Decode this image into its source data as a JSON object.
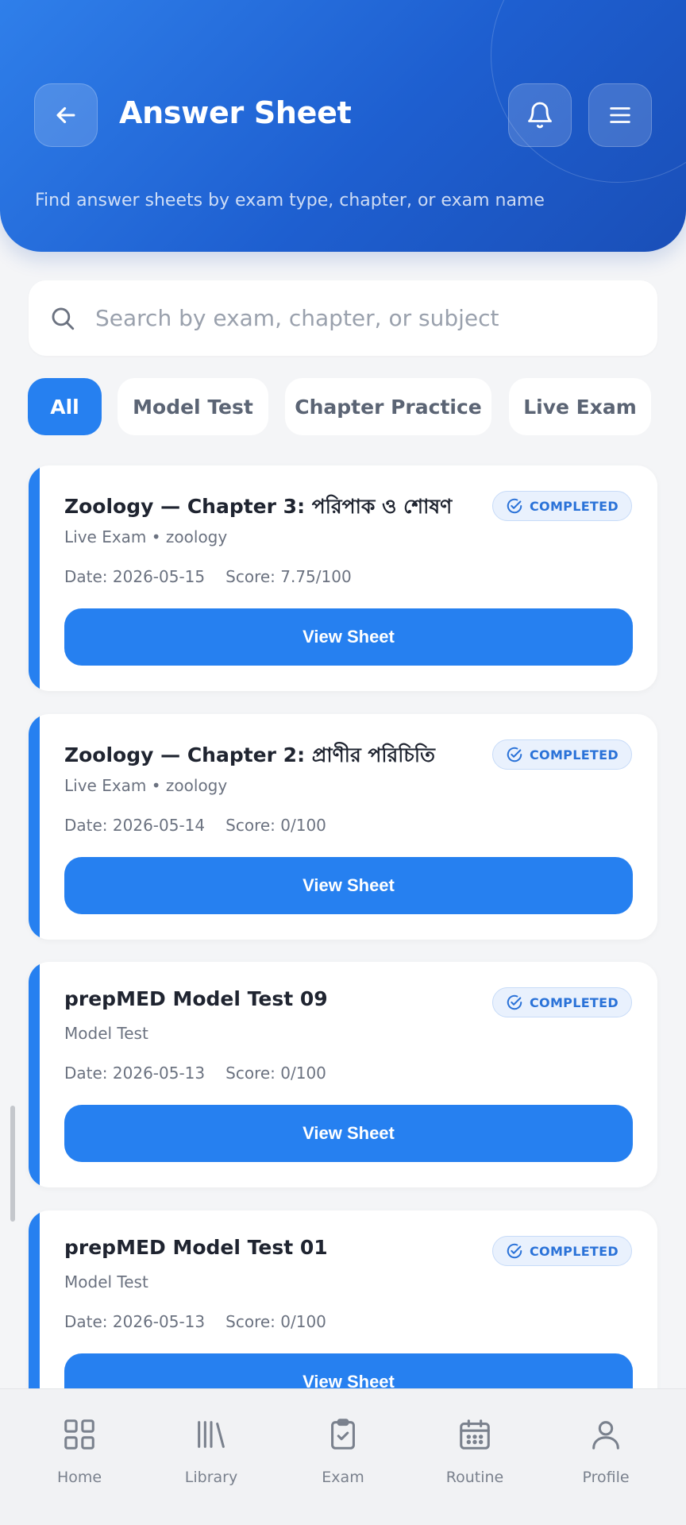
{
  "header": {
    "title": "Answer Sheet",
    "subtitle": "Find answer sheets by exam type, chapter, or exam name"
  },
  "search": {
    "placeholder": "Search by exam, chapter, or subject",
    "value": ""
  },
  "filters": [
    {
      "label": "All",
      "active": true
    },
    {
      "label": "Model Test",
      "active": false
    },
    {
      "label": "Chapter Practice",
      "active": false
    },
    {
      "label": "Live Exam",
      "active": false
    }
  ],
  "cards": [
    {
      "title": "Zoology — Chapter 3: পরিপাক ও শোষণ",
      "meta": "Live Exam • zoology",
      "date": "Date: 2026-05-15",
      "score": "Score: 7.75/100",
      "status": "COMPLETED",
      "button": "View Sheet"
    },
    {
      "title": "Zoology — Chapter 2: প্রাণীর পরিচিতি",
      "meta": "Live Exam • zoology",
      "date": "Date: 2026-05-14",
      "score": "Score: 0/100",
      "status": "COMPLETED",
      "button": "View Sheet"
    },
    {
      "title": "prepMED Model Test 09",
      "meta": "Model Test",
      "date": "Date: 2026-05-13",
      "score": "Score: 0/100",
      "status": "COMPLETED",
      "button": "View Sheet"
    },
    {
      "title": "prepMED Model Test 01",
      "meta": "Model Test",
      "date": "Date: 2026-05-13",
      "score": "Score: 0/100",
      "status": "COMPLETED",
      "button": "View Sheet"
    }
  ],
  "nav": [
    {
      "label": "Home",
      "icon": "grid-icon"
    },
    {
      "label": "Library",
      "icon": "books-icon"
    },
    {
      "label": "Exam",
      "icon": "clipboard-check-icon"
    },
    {
      "label": "Routine",
      "icon": "calendar-icon"
    },
    {
      "label": "Profile",
      "icon": "user-icon"
    }
  ],
  "colors": {
    "primary": "#2680f0",
    "header_start": "#2f7fea",
    "header_end": "#1a4fb8",
    "badge_bg": "#e9f1fd",
    "badge_text": "#2a72d8"
  }
}
